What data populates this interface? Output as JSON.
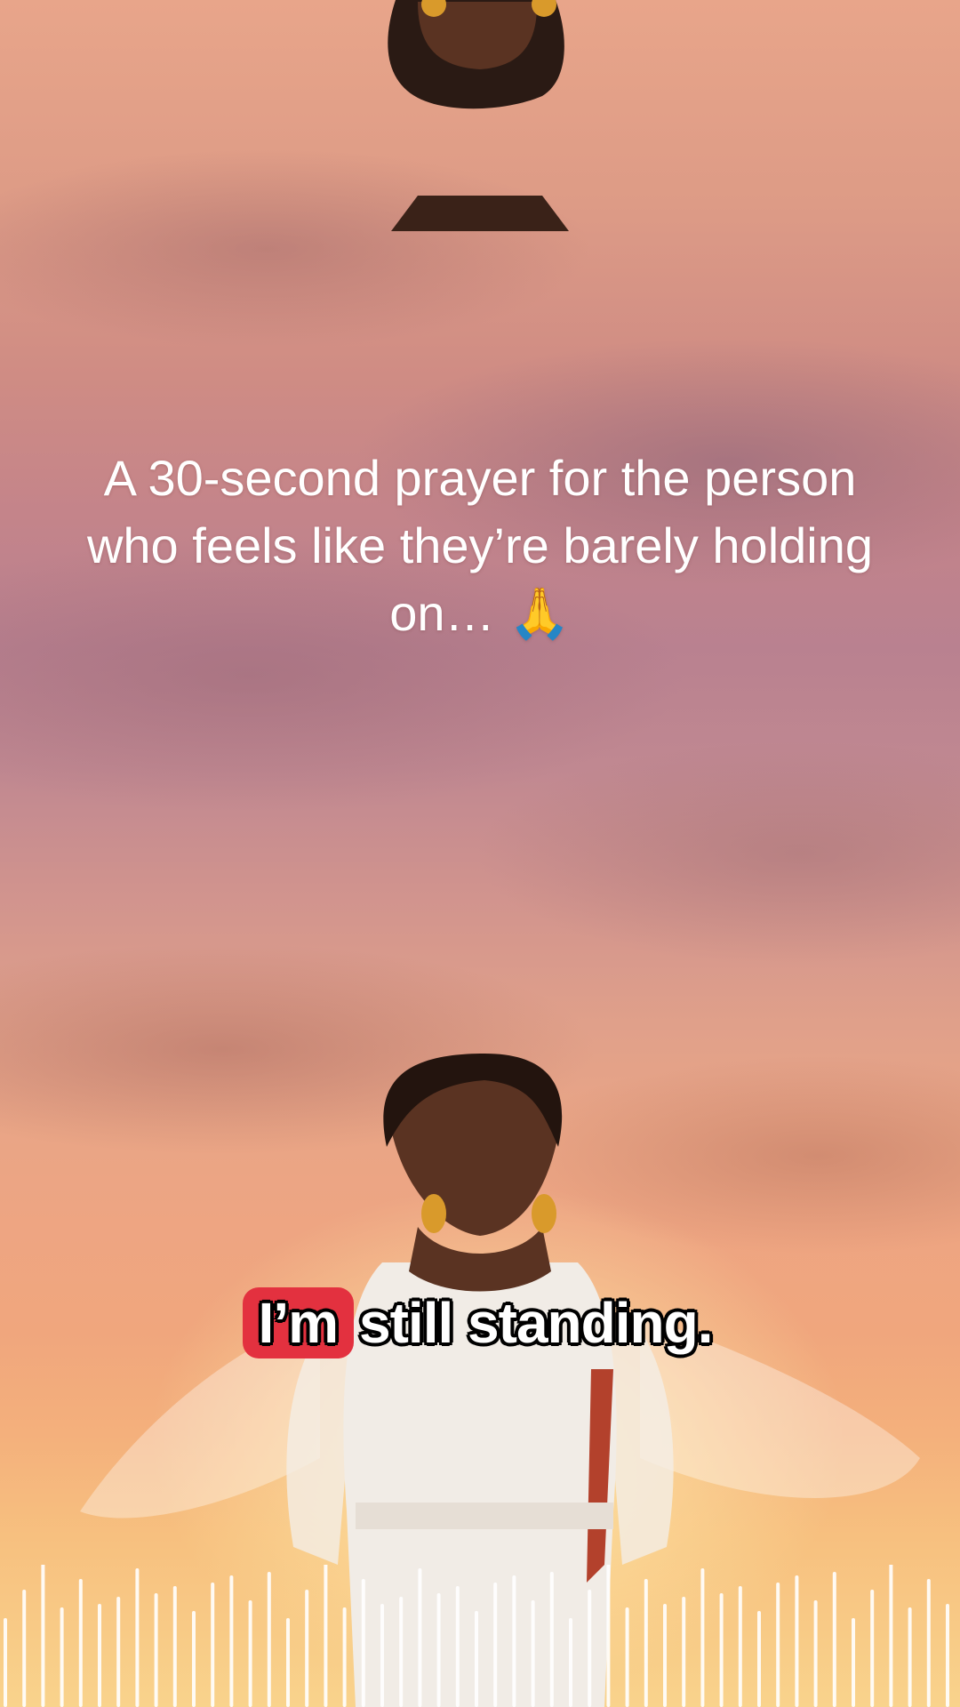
{
  "video": {
    "caption": "A 30-second prayer for the person who feels like they’re barely holding on… 🙏",
    "subtitle": {
      "highlighted_word": "I’m",
      "rest": "still standing."
    },
    "colors": {
      "subtitle_highlight": "#e3313f",
      "subtitle_text": "#ffffff",
      "caption_text": "#ffffff",
      "waveform": "#ffffff"
    }
  }
}
